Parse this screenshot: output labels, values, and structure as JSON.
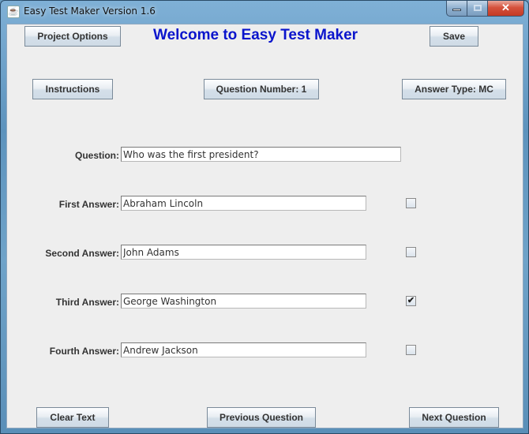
{
  "window": {
    "title": "Easy Test Maker Version 1.6",
    "controls": {
      "minimize": "minimize",
      "maximize": "maximize",
      "close": "✕"
    }
  },
  "header": {
    "project_options_label": "Project Options",
    "welcome_title": "Welcome to Easy Test Maker",
    "save_label": "Save"
  },
  "toolbar": {
    "instructions_label": "Instructions",
    "question_number_label": "Question Number: 1",
    "answer_type_label": "Answer Type: MC"
  },
  "form": {
    "question": {
      "label": "Question:",
      "value": "Who was the first president?"
    },
    "answers": [
      {
        "label": "First Answer:",
        "value": "Abraham Lincoln",
        "correct": false
      },
      {
        "label": "Second Answer:",
        "value": "John Adams",
        "correct": false
      },
      {
        "label": "Third Answer:",
        "value": "George Washington",
        "correct": true
      },
      {
        "label": "Fourth Answer:",
        "value": "Andrew Jackson",
        "correct": false
      }
    ]
  },
  "footer": {
    "clear_text_label": "Clear Text",
    "previous_question_label": "Previous Question",
    "next_question_label": "Next Question"
  },
  "colors": {
    "title_blue": "#0a14cc",
    "panel_bg": "#eeeeee"
  }
}
